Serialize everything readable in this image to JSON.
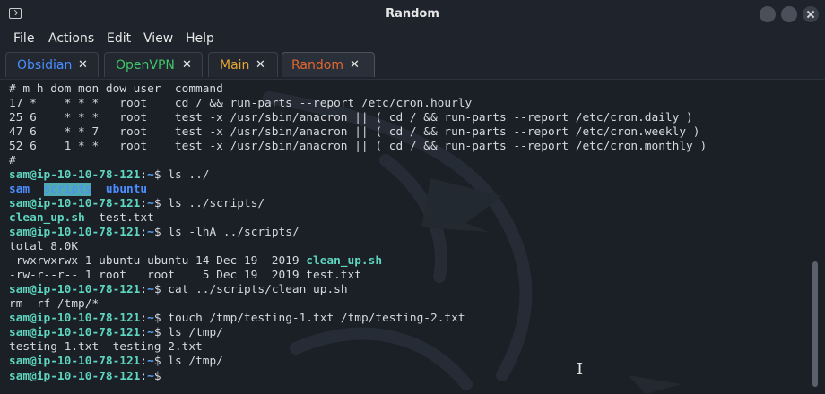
{
  "window": {
    "title": "Random",
    "icon": "terminal-icon"
  },
  "menu": [
    "File",
    "Actions",
    "Edit",
    "View",
    "Help"
  ],
  "tabs": [
    {
      "label": "Obsidian",
      "color": "#4a8cff"
    },
    {
      "label": "OpenVPN",
      "color": "#3fc66a"
    },
    {
      "label": "Main",
      "color": "#e5a632"
    },
    {
      "label": "Random",
      "color": "#e3662f"
    }
  ],
  "tab_close_glyph": "✕",
  "prompt": {
    "user": "sam@ip-10-10-78-121",
    "colon": ":",
    "path": "~",
    "sign": "$ "
  },
  "colors": {
    "prompt": "#5ed6c0",
    "path": "#5aa7ff",
    "dir": "#4c8dff",
    "text": "#d6d9dd",
    "bg": "#1b1f26"
  },
  "output": [
    {
      "type": "text",
      "text": "# m h dom mon dow user  command"
    },
    {
      "type": "text",
      "text": "17 *    * * *   root    cd / && run-parts --report /etc/cron.hourly"
    },
    {
      "type": "text",
      "text": "25 6    * * *   root    test -x /usr/sbin/anacron || ( cd / && run-parts --report /etc/cron.daily )"
    },
    {
      "type": "text",
      "text": "47 6    * * 7   root    test -x /usr/sbin/anacron || ( cd / && run-parts --report /etc/cron.weekly )"
    },
    {
      "type": "text",
      "text": "52 6    1 * *   root    test -x /usr/sbin/anacron || ( cd / && run-parts --report /etc/cron.monthly )"
    },
    {
      "type": "text",
      "text": "#"
    },
    {
      "type": "prompt",
      "cmd": "ls ../"
    },
    {
      "type": "parts",
      "parts": [
        {
          "t": "sam",
          "c": "dir"
        },
        {
          "t": "  ",
          "c": ""
        },
        {
          "t": "scripts",
          "c": "dir-hl"
        },
        {
          "t": "  ",
          "c": ""
        },
        {
          "t": "ubuntu",
          "c": "dir"
        }
      ]
    },
    {
      "type": "prompt",
      "cmd": "ls ../scripts/"
    },
    {
      "type": "parts",
      "parts": [
        {
          "t": "clean_up.sh",
          "c": "exe"
        },
        {
          "t": "  test.txt",
          "c": ""
        }
      ]
    },
    {
      "type": "prompt",
      "cmd": "ls -lhA ../scripts/"
    },
    {
      "type": "text",
      "text": "total 8.0K"
    },
    {
      "type": "parts",
      "parts": [
        {
          "t": "-rwxrwxrwx 1 ubuntu ubuntu 14 Dec 19  2019 ",
          "c": ""
        },
        {
          "t": "clean_up.sh",
          "c": "exe"
        }
      ]
    },
    {
      "type": "text",
      "text": "-rw-r--r-- 1 root   root    5 Dec 19  2019 test.txt"
    },
    {
      "type": "prompt",
      "cmd": "cat ../scripts/clean_up.sh"
    },
    {
      "type": "text",
      "text": "rm -rf /tmp/*"
    },
    {
      "type": "prompt",
      "cmd": "touch /tmp/testing-1.txt /tmp/testing-2.txt"
    },
    {
      "type": "prompt",
      "cmd": "ls /tmp/"
    },
    {
      "type": "text",
      "text": "testing-1.txt  testing-2.txt"
    },
    {
      "type": "prompt",
      "cmd": "ls /tmp/"
    },
    {
      "type": "prompt",
      "cmd": "",
      "cursor": true
    }
  ]
}
